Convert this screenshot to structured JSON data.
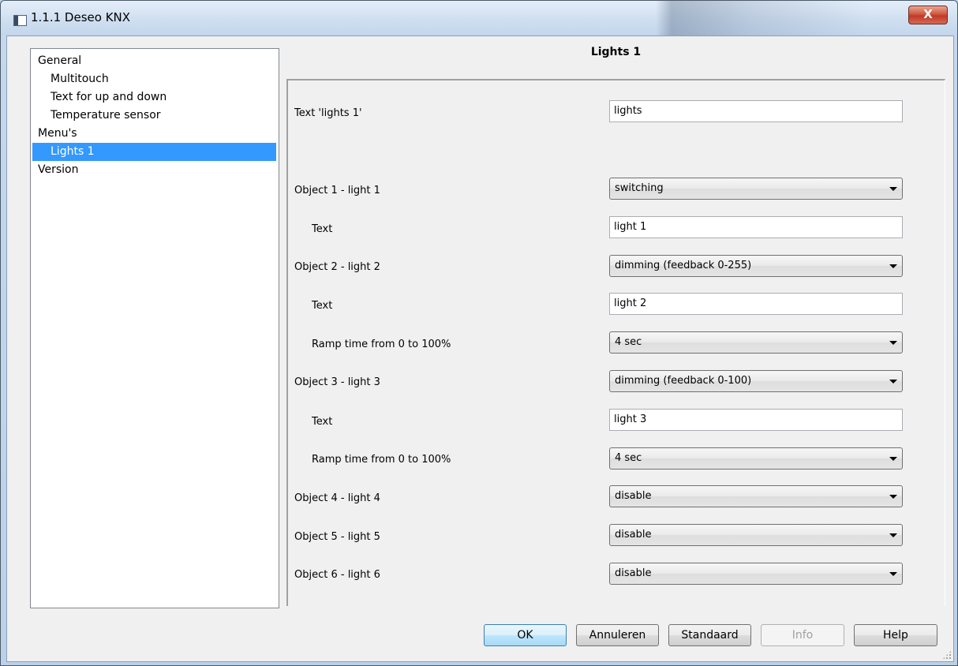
{
  "window": {
    "title": "1.1.1 Deseo KNX",
    "close_glyph": "X"
  },
  "tree": {
    "items": [
      {
        "label": "General",
        "level": 0
      },
      {
        "label": "Multitouch",
        "level": 1
      },
      {
        "label": "Text for up and down",
        "level": 1
      },
      {
        "label": "Temperature sensor",
        "level": 1
      },
      {
        "label": "Menu's",
        "level": 0
      },
      {
        "label": "Lights 1",
        "level": 1,
        "selected": true
      },
      {
        "label": "Version",
        "level": 0
      }
    ]
  },
  "panel": {
    "title": "Lights 1",
    "rows": [
      {
        "label": "Text 'lights 1'",
        "type": "text",
        "value": "lights",
        "indent": false
      },
      {
        "label": "Object 1 - light 1",
        "type": "select",
        "value": "switching",
        "indent": false
      },
      {
        "label": "Text",
        "type": "text",
        "value": "light 1",
        "indent": true
      },
      {
        "label": "Object 2 - light 2",
        "type": "select",
        "value": "dimming (feedback 0-255)",
        "indent": false
      },
      {
        "label": "Text",
        "type": "text",
        "value": "light 2",
        "indent": true
      },
      {
        "label": "Ramp time from 0 to 100%",
        "type": "select",
        "value": "4 sec",
        "indent": true
      },
      {
        "label": "Object 3 - light 3",
        "type": "select",
        "value": "dimming (feedback 0-100)",
        "indent": false
      },
      {
        "label": "Text",
        "type": "text",
        "value": "light 3",
        "indent": true
      },
      {
        "label": "Ramp time from 0 to 100%",
        "type": "select",
        "value": "4 sec",
        "indent": true
      },
      {
        "label": "Object 4 - light 4",
        "type": "select",
        "value": "disable",
        "indent": false
      },
      {
        "label": "Object 5 - light 5",
        "type": "select",
        "value": "disable",
        "indent": false
      },
      {
        "label": "Object 6 - light 6",
        "type": "select",
        "value": "disable",
        "indent": false
      }
    ]
  },
  "buttons": {
    "ok": "OK",
    "cancel": "Annuleren",
    "standard": "Standaard",
    "info": "Info",
    "help": "Help"
  }
}
